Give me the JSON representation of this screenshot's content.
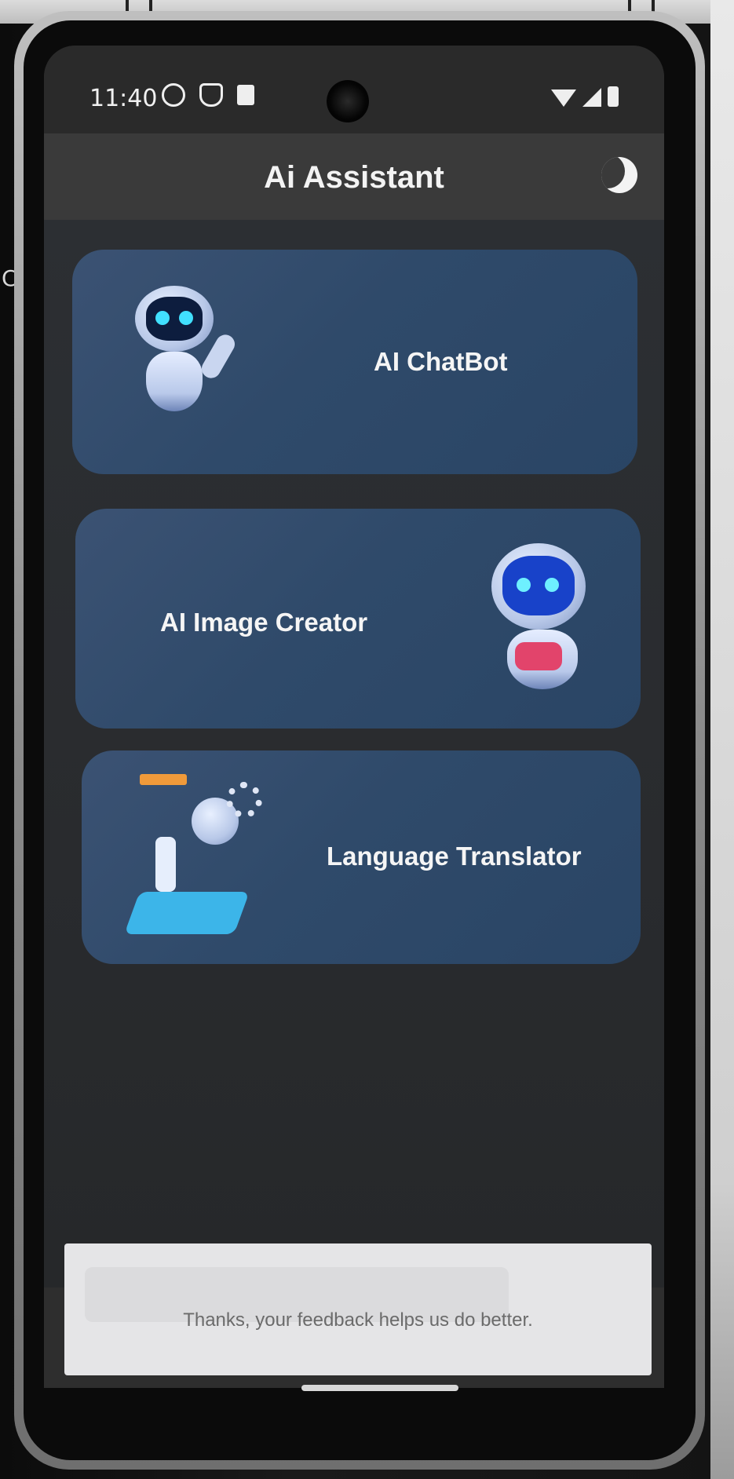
{
  "status_bar": {
    "time": "11:40",
    "icons_left": [
      "alarm-icon",
      "shield-icon",
      "document-icon"
    ],
    "icons_right": [
      "wifi-icon",
      "signal-icon",
      "battery-icon"
    ]
  },
  "app_bar": {
    "title": "Ai Assistant",
    "theme_toggle_icon": "moon-icon"
  },
  "cards": [
    {
      "label": "AI ChatBot",
      "illustration": "waving-robot-icon"
    },
    {
      "label": "AI Image Creator",
      "illustration": "gamer-robot-icon"
    },
    {
      "label": "Language Translator",
      "illustration": "translator-robot-icon"
    }
  ],
  "feedback": {
    "message": "Thanks, your feedback helps us do better."
  },
  "background_edge_text": "C",
  "colors": {
    "card": "#34506f",
    "app_bar": "#3a3a3a",
    "screen_bg": "#2b2d30",
    "text": "#f5f5f5"
  }
}
